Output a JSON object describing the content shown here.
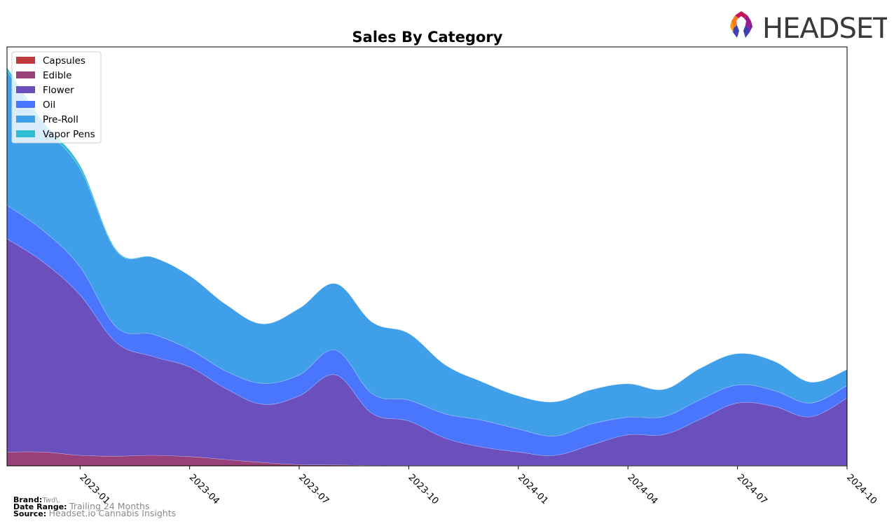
{
  "brand_logo": {
    "text": "HEADSET"
  },
  "footer": {
    "brand_label": "Brand:",
    "brand_value": "Twd\\.",
    "date_range_label": "Date Range:",
    "date_range_value": "Trailing 24 Months",
    "source_label": "Source:",
    "source_value": "Headset.io Cannabis Insights"
  },
  "chart_data": {
    "type": "area",
    "stacked": true,
    "title": "Sales By Category",
    "xlabel": "",
    "ylabel": "",
    "y_axis_visible": false,
    "grid": false,
    "legend_position": "top-left",
    "ylim": [
      0,
      100
    ],
    "x": [
      "2022-11",
      "2022-12",
      "2023-01",
      "2023-02",
      "2023-03",
      "2023-04",
      "2023-05",
      "2023-06",
      "2023-07",
      "2023-08",
      "2023-09",
      "2023-10",
      "2023-11",
      "2023-12",
      "2024-01",
      "2024-02",
      "2024-03",
      "2024-04",
      "2024-05",
      "2024-06",
      "2024-07",
      "2024-08",
      "2024-09",
      "2024-10"
    ],
    "x_ticks": [
      "2023-01",
      "2023-04",
      "2023-07",
      "2023-10",
      "2024-01",
      "2024-04",
      "2024-07",
      "2024-10"
    ],
    "series": [
      {
        "name": "Capsules",
        "color": "#c0393b",
        "values": [
          0,
          0,
          0,
          0,
          0,
          0,
          0,
          0,
          0,
          0,
          0,
          0,
          0,
          0,
          0,
          0,
          0,
          0,
          0,
          0,
          0,
          0,
          0,
          0
        ]
      },
      {
        "name": "Edible",
        "color": "#993f7a",
        "values": [
          3.3,
          3.3,
          2.5,
          2.3,
          2.5,
          2.2,
          1.5,
          0.8,
          0.3,
          0.2,
          0.1,
          0.1,
          0.1,
          0.1,
          0.1,
          0.1,
          0.1,
          0.1,
          0.1,
          0.1,
          0.1,
          0.1,
          0.1,
          0.1
        ]
      },
      {
        "name": "Flower",
        "color": "#6a4fbd",
        "values": [
          50.9,
          45.3,
          38.3,
          27.1,
          23.6,
          21.4,
          16.9,
          13.9,
          16.4,
          21.5,
          12.4,
          10.6,
          6.5,
          4.4,
          3.2,
          2.4,
          4.9,
          7.3,
          7.4,
          11.1,
          14.9,
          14.1,
          11.6,
          16.1
        ]
      },
      {
        "name": "Oil",
        "color": "#4a76fe",
        "values": [
          8.0,
          7.5,
          6.7,
          3.7,
          5.3,
          4.2,
          4.2,
          5.0,
          5.0,
          5.9,
          4.7,
          5.0,
          5.8,
          6.4,
          5.5,
          4.6,
          5.0,
          4.2,
          4.3,
          4.7,
          4.3,
          3.8,
          3.3,
          3.0
        ]
      },
      {
        "name": "Pre-Roll",
        "color": "#3f9fe8",
        "values": [
          32.1,
          25.1,
          23.4,
          18.1,
          18.4,
          17.6,
          15.9,
          14.2,
          15.9,
          15.9,
          17.1,
          15.9,
          11.7,
          9.2,
          7.9,
          8.2,
          8.2,
          8.0,
          6.5,
          7.5,
          7.5,
          7.0,
          5.0,
          3.8
        ]
      },
      {
        "name": "Vapor Pens",
        "color": "#2fbdd3",
        "values": [
          0.8,
          0.8,
          0.8,
          0.3,
          0,
          0,
          0,
          0,
          0,
          0,
          0,
          0,
          0,
          0,
          0,
          0,
          0,
          0,
          0,
          0,
          0,
          0,
          0,
          0
        ]
      }
    ]
  }
}
